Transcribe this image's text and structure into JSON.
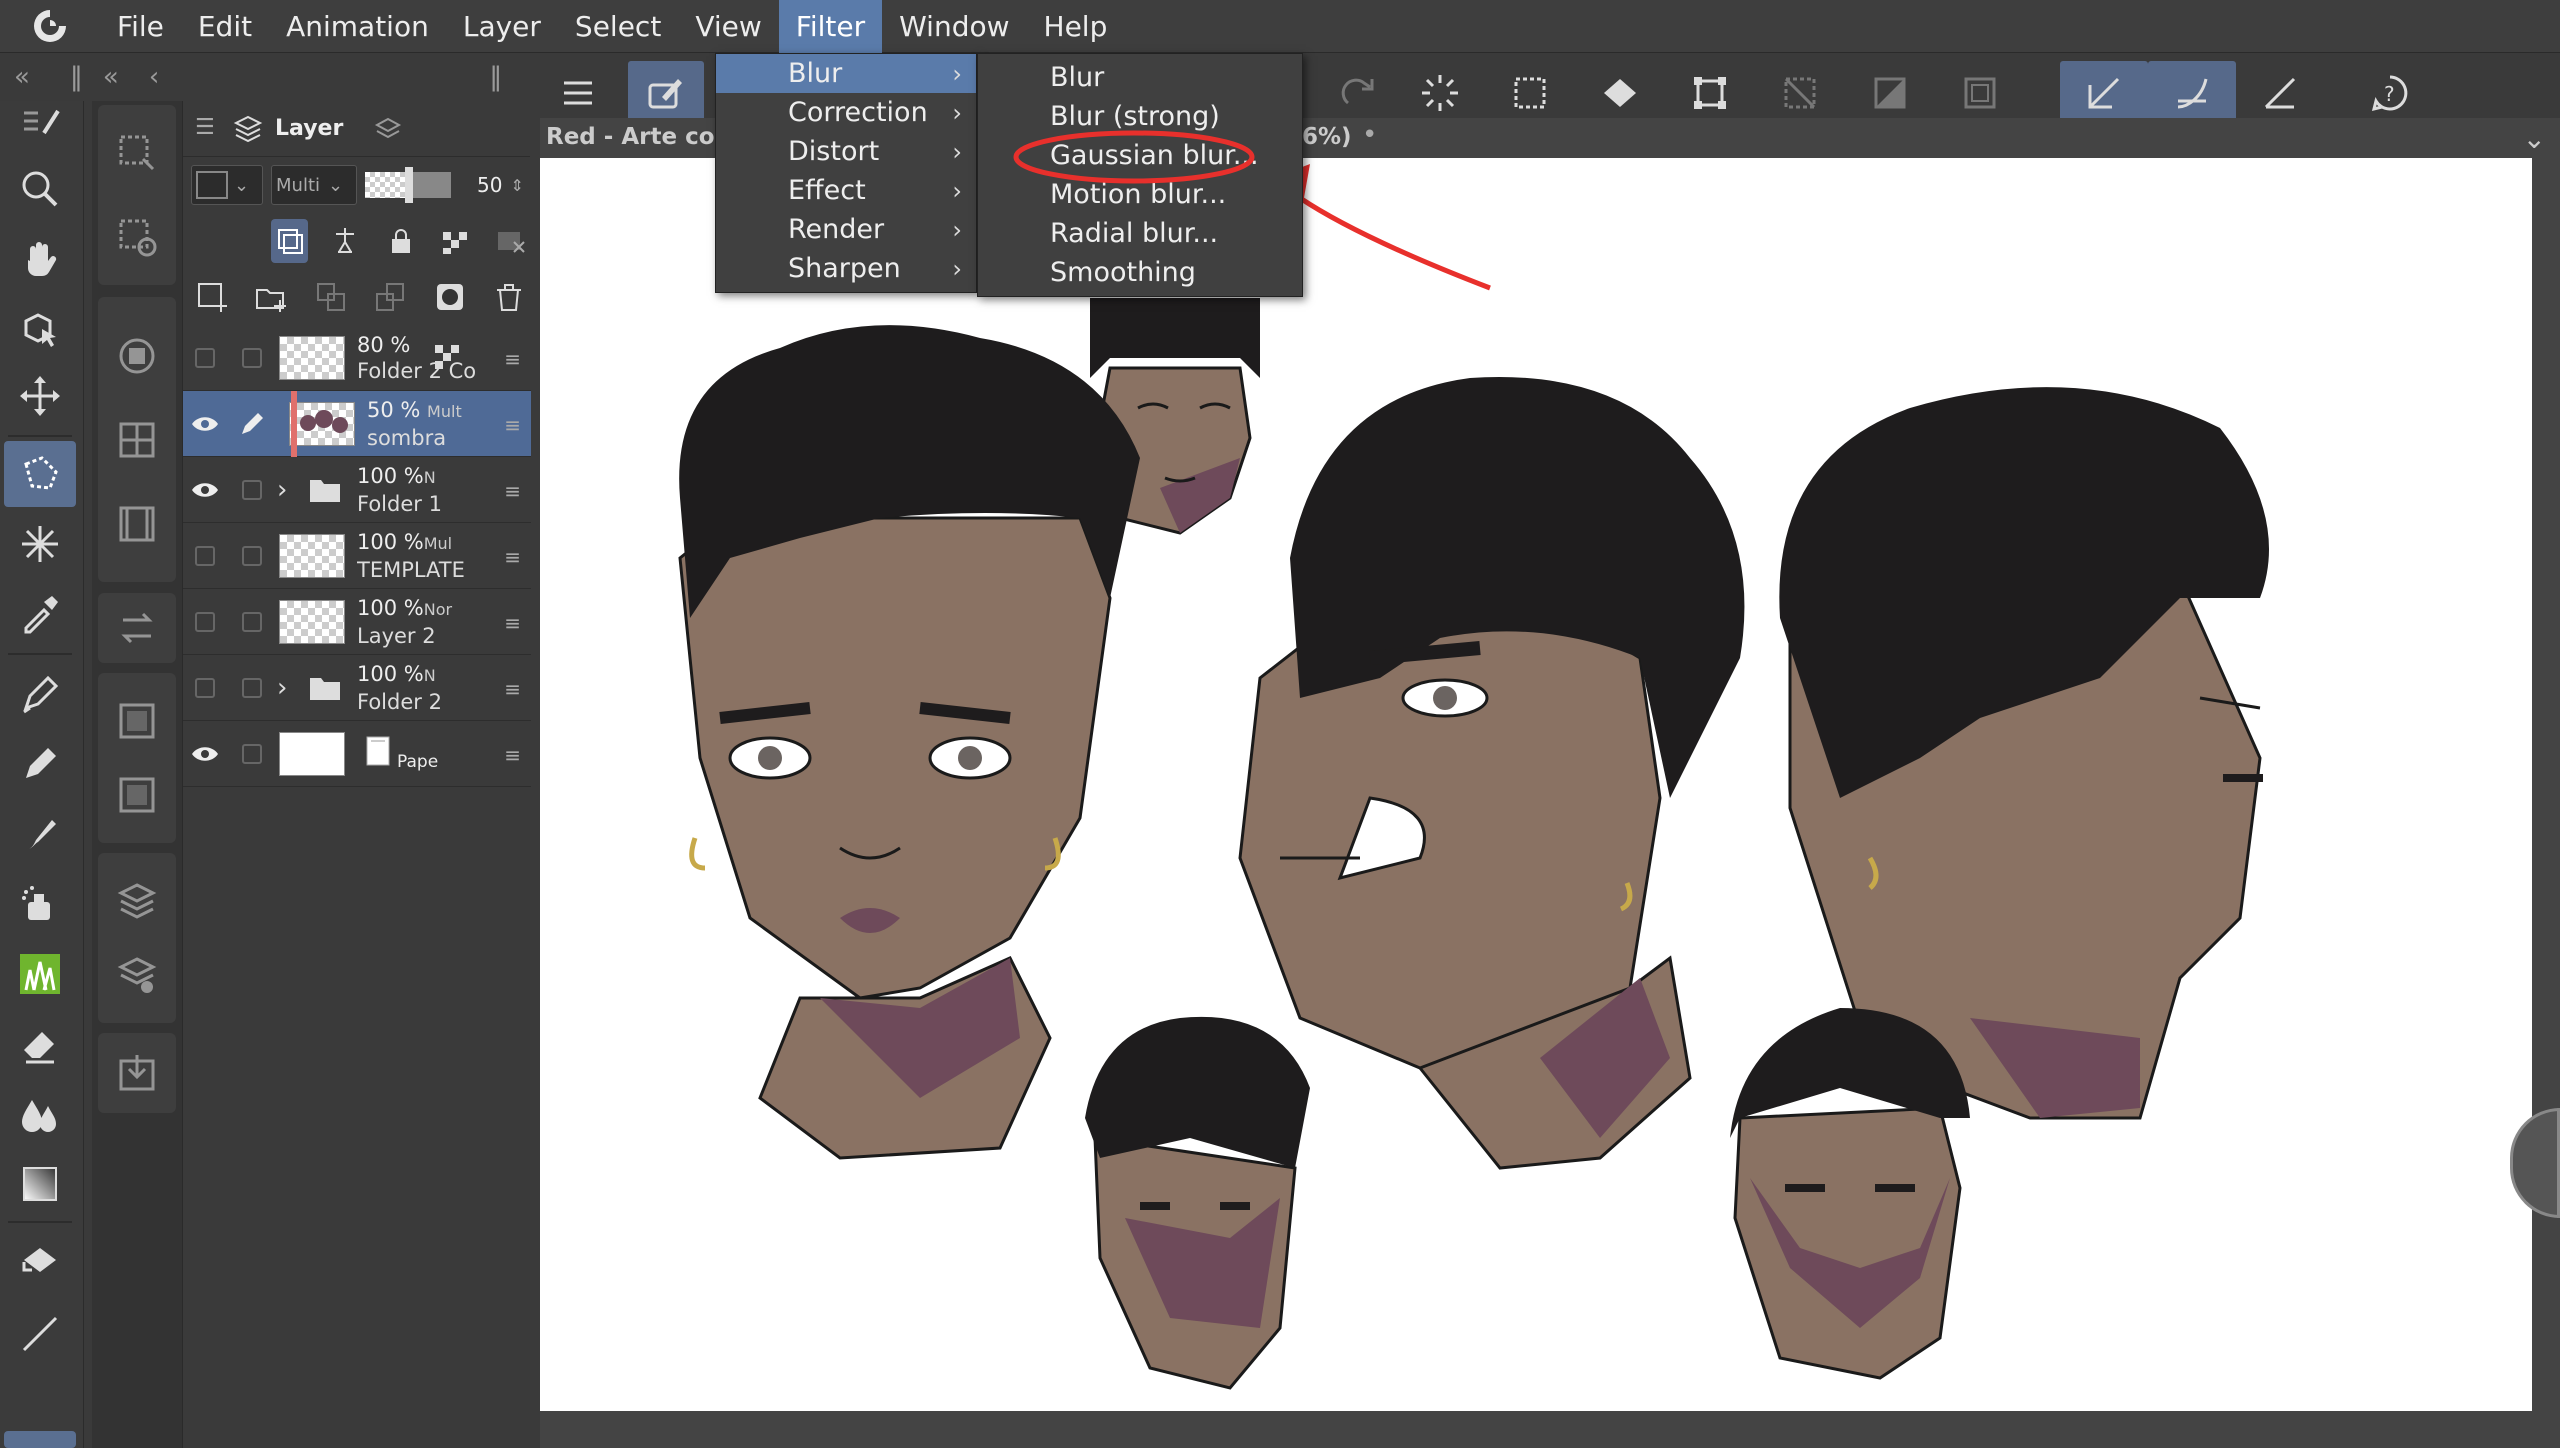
{
  "menubar": {
    "items": [
      "File",
      "Edit",
      "Animation",
      "Layer",
      "Select",
      "View",
      "Filter",
      "Window",
      "Help"
    ],
    "active": "Filter"
  },
  "filter_menu": {
    "items": [
      {
        "label": "Blur",
        "has_submenu": true
      },
      {
        "label": "Correction",
        "has_submenu": true
      },
      {
        "label": "Distort",
        "has_submenu": true
      },
      {
        "label": "Effect",
        "has_submenu": true
      },
      {
        "label": "Render",
        "has_submenu": true
      },
      {
        "label": "Sharpen",
        "has_submenu": true
      }
    ],
    "highlighted": "Blur"
  },
  "blur_submenu": {
    "items": [
      "Blur",
      "Blur (strong)",
      "Gaussian blur...",
      "Motion blur...",
      "Radial blur...",
      "Smoothing"
    ],
    "circled": "Gaussian blur..."
  },
  "canvas": {
    "title": "Red - Arte conc",
    "zoom_fragment": "6%)"
  },
  "layer_panel": {
    "tab_label": "Layer",
    "blend_mode": "Multi",
    "opacity": "50",
    "layers": [
      {
        "opacity": "80 %",
        "mode": "",
        "name": "Folder 2 Co|",
        "visible": false,
        "type": "raster",
        "selected": false
      },
      {
        "opacity": "50 %",
        "mode": "Mult",
        "name": "sombra",
        "visible": true,
        "type": "raster",
        "selected": true
      },
      {
        "opacity": "100 %",
        "mode": "N",
        "name": "Folder 1",
        "visible": true,
        "type": "folder",
        "selected": false
      },
      {
        "opacity": "100 %",
        "mode": "Mul",
        "name": "TEMPLATE",
        "visible": false,
        "type": "raster",
        "selected": false
      },
      {
        "opacity": "100 %",
        "mode": "Nor",
        "name": "Layer 2",
        "visible": false,
        "type": "raster",
        "selected": false
      },
      {
        "opacity": "100 %",
        "mode": "N",
        "name": "Folder 2",
        "visible": false,
        "type": "folder",
        "selected": false
      },
      {
        "opacity": "",
        "mode": "",
        "name": "Pape",
        "visible": true,
        "type": "paper",
        "selected": false
      }
    ]
  },
  "colors": {
    "menu_highlight": "#5a7baa",
    "selected_layer": "#4f6a96",
    "annotation_red": "#e8302c",
    "skin": "#8a7263",
    "shadow": "#6e4a5a",
    "hair": "#1e1c1d"
  }
}
